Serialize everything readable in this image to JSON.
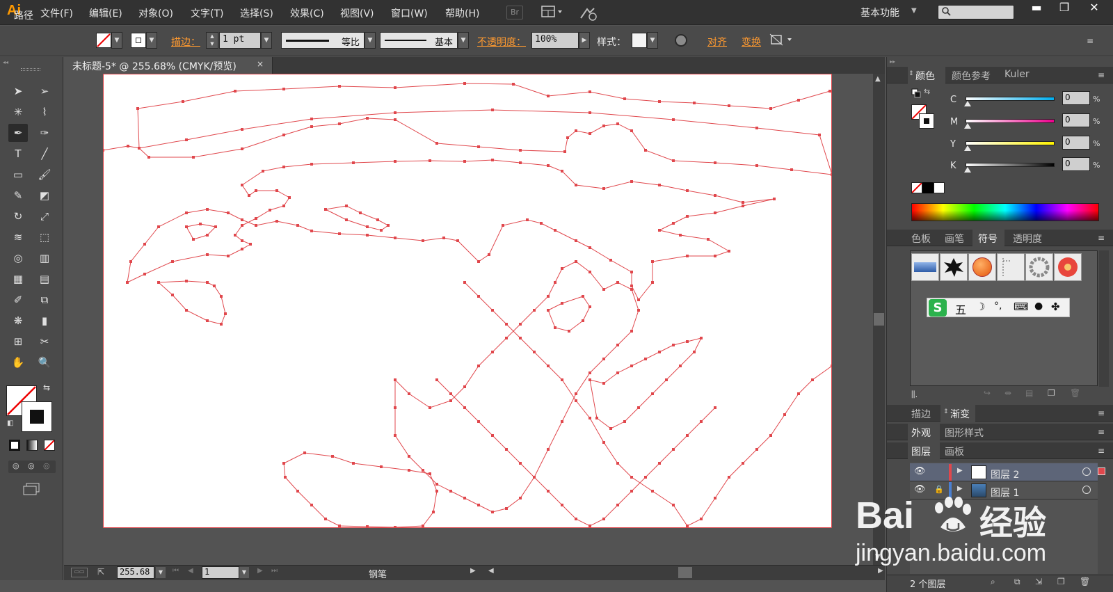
{
  "app": {
    "logo": "Ai"
  },
  "menu": {
    "items": [
      "文件(F)",
      "编辑(E)",
      "对象(O)",
      "文字(T)",
      "选择(S)",
      "效果(C)",
      "视图(V)",
      "窗口(W)",
      "帮助(H)"
    ],
    "bridge_label": "Br",
    "workspace": "基本功能",
    "search_placeholder": ""
  },
  "window_controls": {
    "minimize": "▬",
    "restore": "❐",
    "close": "✕"
  },
  "control_bar": {
    "path_label": "路径",
    "stroke_label": "描边：",
    "stroke_weight": "1 pt",
    "profile_label": "等比",
    "brush_label": "基本",
    "opacity_label": "不透明度：",
    "opacity_value": "100%",
    "style_label": "样式：",
    "align_label": "对齐",
    "transform_label": "变换"
  },
  "document": {
    "tab_title": "未标题-5* @ 255.68% (CMYK/预览)",
    "tab_close": "×",
    "path_color": "#e0474c"
  },
  "status_bar": {
    "zoom": "255.68",
    "artboard": "1",
    "current_tool": "钢笔"
  },
  "color_panel": {
    "tabs": [
      "颜色",
      "颜色参考",
      "Kuler"
    ],
    "channels": [
      {
        "letter": "C",
        "value": "0",
        "unit": "%"
      },
      {
        "letter": "M",
        "value": "0",
        "unit": "%"
      },
      {
        "letter": "Y",
        "value": "0",
        "unit": "%"
      },
      {
        "letter": "K",
        "value": "0",
        "unit": "%"
      }
    ]
  },
  "symbols_panel": {
    "tabs": [
      "色板",
      "画笔",
      "符号",
      "透明度"
    ],
    "ime_bar": [
      "五",
      "☽",
      "°,",
      "⌨",
      "●",
      "✤"
    ]
  },
  "stroke_panel": {
    "tabs": [
      "描边",
      "渐变"
    ]
  },
  "appearance_panel": {
    "tabs": [
      "外观",
      "图形样式"
    ]
  },
  "layers_panel": {
    "tabs": [
      "图层",
      "画板"
    ],
    "layers": [
      {
        "name": "图层 2",
        "selected": true,
        "color": "#e0474c"
      },
      {
        "name": "图层 1",
        "selected": false,
        "color": "#4a7fd0"
      }
    ],
    "footer": "2 个图层"
  },
  "watermark": {
    "brand": "Bai",
    "brand2": "经验",
    "url": "jingyan.baidu.com"
  },
  "tools": [
    "selection-tool",
    "direct-selection-tool",
    "magic-wand-tool",
    "lasso-tool",
    "pen-tool",
    "curvature-tool",
    "type-tool",
    "line-tool",
    "rectangle-tool",
    "paintbrush-tool",
    "pencil-tool",
    "eraser-tool",
    "rotate-tool",
    "scale-tool",
    "warp-tool",
    "free-transform-tool",
    "shape-builder-tool",
    "graph-tool",
    "mesh-tool",
    "gradient-tool",
    "eyedropper-tool",
    "blend-tool",
    "symbol-sprayer-tool",
    "column-graph-tool",
    "artboard-tool",
    "slice-tool",
    "hand-tool",
    "zoom-tool"
  ],
  "tool_glyphs": [
    "➤",
    "➢",
    "✳",
    "⌇",
    "✒",
    "✑",
    "T",
    "╱",
    "▭",
    "🖌",
    "✎",
    "◩",
    "↻",
    "⤢",
    "≋",
    "⬚",
    "◎",
    "▥",
    "▦",
    "▤",
    "✐",
    "⧉",
    "❋",
    "▮",
    "⊞",
    "✂",
    "✋",
    "🔍"
  ]
}
